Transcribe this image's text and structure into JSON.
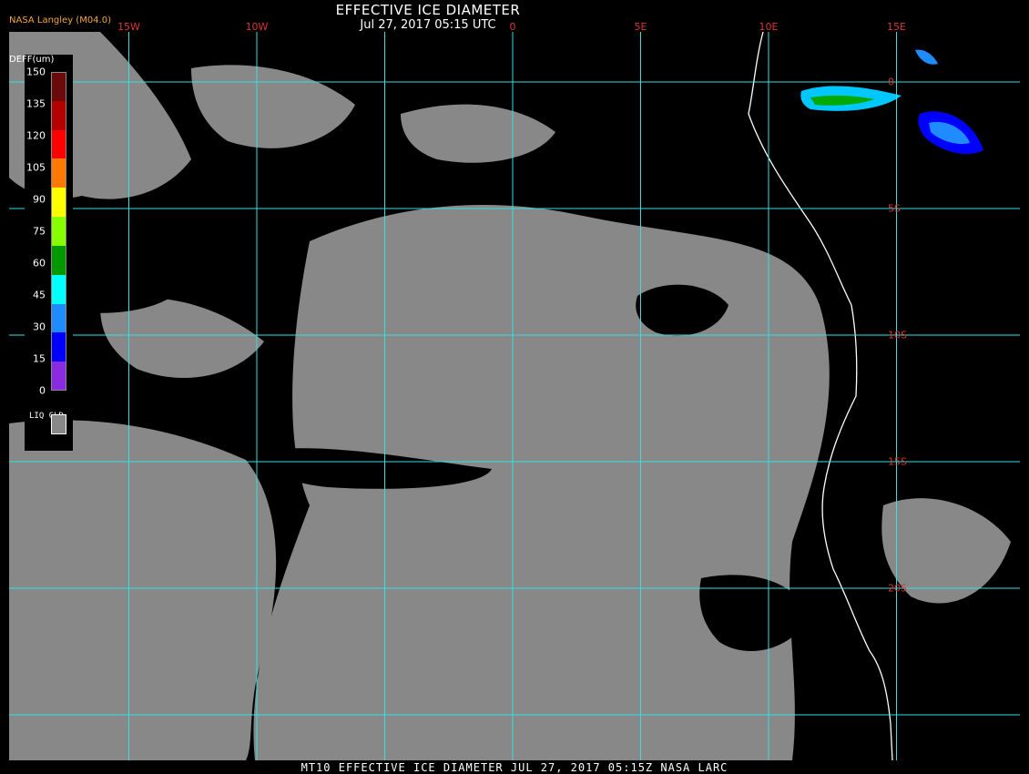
{
  "header": {
    "title": "EFFECTIVE ICE DIAMETER",
    "subtitle": "Jul 27, 2017 05:15 UTC",
    "credit": "NASA Langley (M04.0)"
  },
  "footer": {
    "caption": "MT10  EFFECTIVE ICE DIAMETER  JUL 27, 2017 05:15Z  NASA LARC"
  },
  "grid": {
    "color": "#35e0e0",
    "longitudes": [
      {
        "label": "15W",
        "value": -15
      },
      {
        "label": "10W",
        "value": -10
      },
      {
        "label": "0",
        "value": 0
      },
      {
        "label": "5E",
        "value": 5
      },
      {
        "label": "10E",
        "value": 10
      },
      {
        "label": "15E",
        "value": 15
      }
    ],
    "latitudes": [
      {
        "label": "0",
        "value": 0
      },
      {
        "label": "5S",
        "value": -5
      },
      {
        "label": "10S",
        "value": -10
      },
      {
        "label": "15S",
        "value": -15
      },
      {
        "label": "20S",
        "value": -20
      }
    ]
  },
  "legend": {
    "title": "DEFF(um)",
    "ticks": [
      "150",
      "135",
      "120",
      "105",
      "90",
      "75",
      "60",
      "45",
      "30",
      "15",
      "0"
    ],
    "colors": [
      "#6b0a0a",
      "#b30000",
      "#ff0000",
      "#ff7800",
      "#ffff00",
      "#88ff00",
      "#009a00",
      "#00ffff",
      "#1e8cff",
      "#0000ff",
      "#8a2be2"
    ],
    "liquid_label": "LIQ CLD",
    "liquid_color": "#888888"
  },
  "map": {
    "cloud_color": "#888888",
    "clear_color": "#000000",
    "coast_color": "#ffffff"
  }
}
